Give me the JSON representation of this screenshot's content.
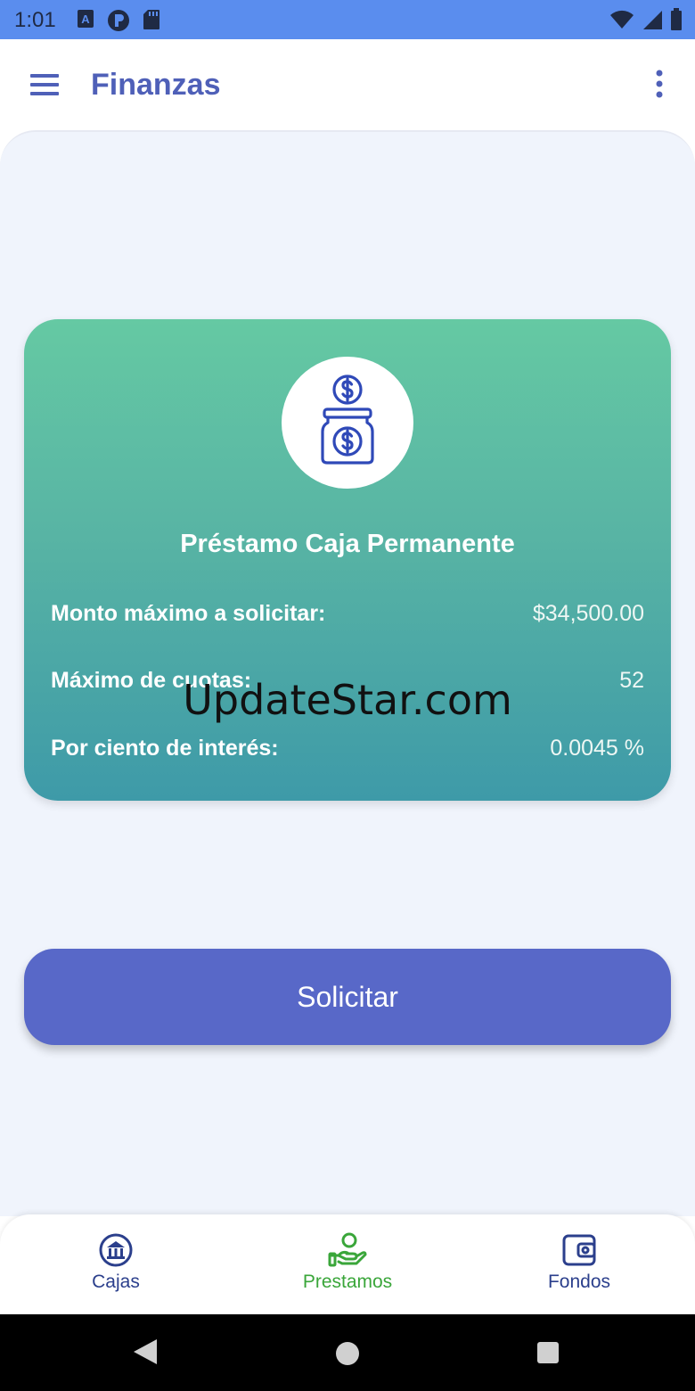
{
  "status_bar": {
    "time": "1:01",
    "colors": {
      "background": "#5a8dee"
    }
  },
  "app_bar": {
    "title": "Finanzas"
  },
  "loan_card": {
    "title": "Préstamo Caja Permanente",
    "rows": [
      {
        "label": "Monto máximo a solicitar:",
        "value": "$34,500.00"
      },
      {
        "label": "Máximo de cuotas:",
        "value": "52"
      },
      {
        "label": "Por ciento de interés:",
        "value": "0.0045 %"
      }
    ],
    "icon": "money-jar-icon"
  },
  "watermark": "UpdateStar.com",
  "action": {
    "label": "Solicitar",
    "color": "#5868c8"
  },
  "bottom_nav": {
    "items": [
      {
        "label": "Cajas",
        "icon": "bank-icon",
        "active": false
      },
      {
        "label": "Prestamos",
        "icon": "hand-person-icon",
        "active": true
      },
      {
        "label": "Fondos",
        "icon": "wallet-icon",
        "active": false
      }
    ],
    "colors": {
      "active": "#3aa63a",
      "inactive": "#2b3f8c"
    }
  }
}
